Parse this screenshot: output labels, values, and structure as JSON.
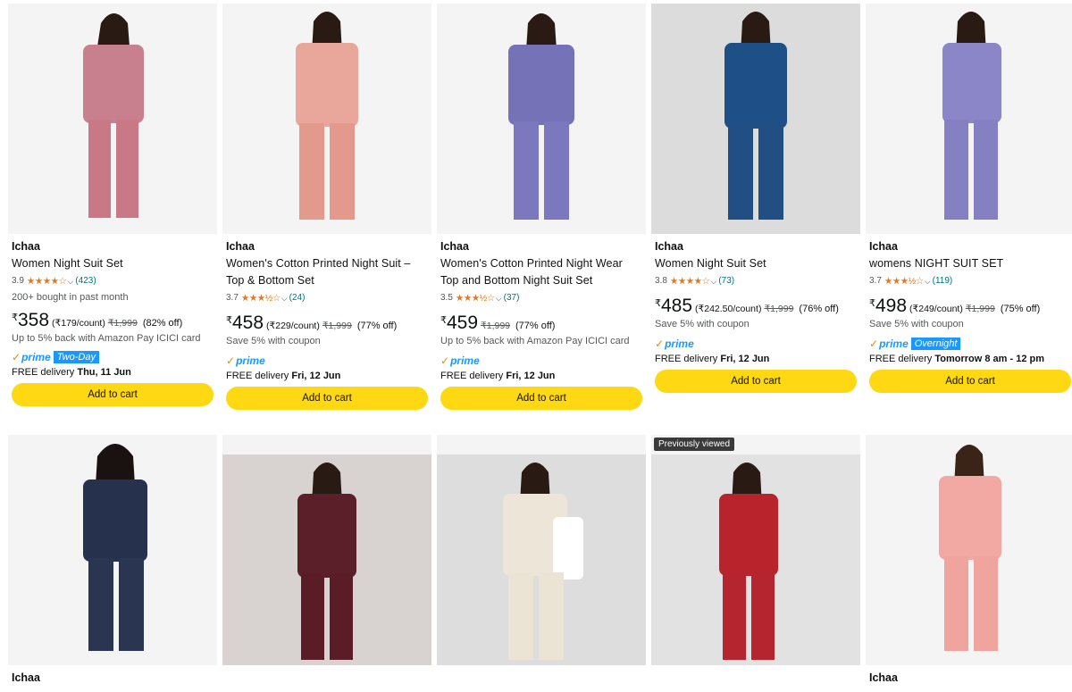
{
  "products": [
    {
      "brand": "Ichaa",
      "title": "Women Night Suit Set",
      "rating": "3.9",
      "stars": "★★★★☆",
      "reviews": "(423)",
      "bought": "200+ bought in past month",
      "currency": "₹",
      "price": "358",
      "unit_price": "(₹179/count)",
      "mrp": "₹1,999",
      "discount": "(82% off)",
      "note": "Up to 5% back with Amazon Pay ICICI card",
      "prime": "prime",
      "prime_tag": "Two-Day",
      "delivery_prefix": "FREE delivery ",
      "delivery_date": "Thu, 11 Jun",
      "cta": "Add to cart",
      "top_color": "#c87f8e",
      "bottom_color": "#c97885"
    },
    {
      "brand": "Ichaa",
      "title": "Women's Cotton Printed Night Suit – Top & Bottom Set",
      "rating": "3.7",
      "stars": "★★★½☆",
      "reviews": "(24)",
      "currency": "₹",
      "price": "458",
      "unit_price": "(₹229/count)",
      "mrp": "₹1,999",
      "discount": "(77% off)",
      "note": "Save 5% with coupon",
      "prime": "prime",
      "delivery_prefix": "FREE delivery ",
      "delivery_date": "Fri, 12 Jun",
      "cta": "Add to cart",
      "top_color": "#e8a79a",
      "bottom_color": "#e39a8c"
    },
    {
      "brand": "Ichaa",
      "title": "Women's Cotton Printed Night Wear Top and Bottom Night Suit Set",
      "rating": "3.5",
      "stars": "★★★½☆",
      "reviews": "(37)",
      "currency": "₹",
      "price": "459",
      "mrp": "₹1,999",
      "discount": "(77% off)",
      "note": "Up to 5% back with Amazon Pay ICICI card",
      "prime": "prime",
      "delivery_prefix": "FREE delivery ",
      "delivery_date": "Fri, 12 Jun",
      "cta": "Add to cart",
      "top_color": "#7572b8",
      "bottom_color": "#7b78bd"
    },
    {
      "brand": "Ichaa",
      "title": "Women Night Suit Set",
      "rating": "3.8",
      "stars": "★★★★☆",
      "reviews": "(73)",
      "currency": "₹",
      "price": "485",
      "unit_price": "(₹242.50/count)",
      "mrp": "₹1,999",
      "discount": "(76% off)",
      "note": "Save 5% with coupon",
      "prime": "prime",
      "delivery_prefix": "FREE delivery ",
      "delivery_date": "Fri, 12 Jun",
      "cta": "Add to cart",
      "top_color": "#1e4f86",
      "bottom_color": "#214f84"
    },
    {
      "brand": "Ichaa",
      "title": "womens NIGHT SUIT SET",
      "rating": "3.7",
      "stars": "★★★½☆",
      "reviews": "(119)",
      "currency": "₹",
      "price": "498",
      "unit_price": "(₹249/count)",
      "mrp": "₹1,999",
      "discount": "(75% off)",
      "note": "Save 5% with coupon",
      "prime": "prime",
      "prime_tag": "Overnight",
      "delivery_prefix": "FREE delivery ",
      "delivery_date": "Tomorrow 8 am - 12 pm",
      "cta": "Add to cart",
      "top_color": "#8b86c7",
      "bottom_color": "#8580c2"
    }
  ],
  "second_row": [
    {
      "brand": "Ichaa",
      "top_color": "#26314d",
      "bottom_color": "#2a3552"
    },
    {
      "top_color": "#5b1f2a",
      "bottom_color": "#5a1d27"
    },
    {
      "top_color": "#ede6d8",
      "bottom_color": "#ebe3d3"
    },
    {
      "badge": "Previously viewed",
      "top_color": "#b8232c",
      "bottom_color": "#b42530"
    },
    {
      "brand": "Ichaa",
      "top_color": "#f2a9a3",
      "bottom_color": "#f0a49e"
    }
  ]
}
